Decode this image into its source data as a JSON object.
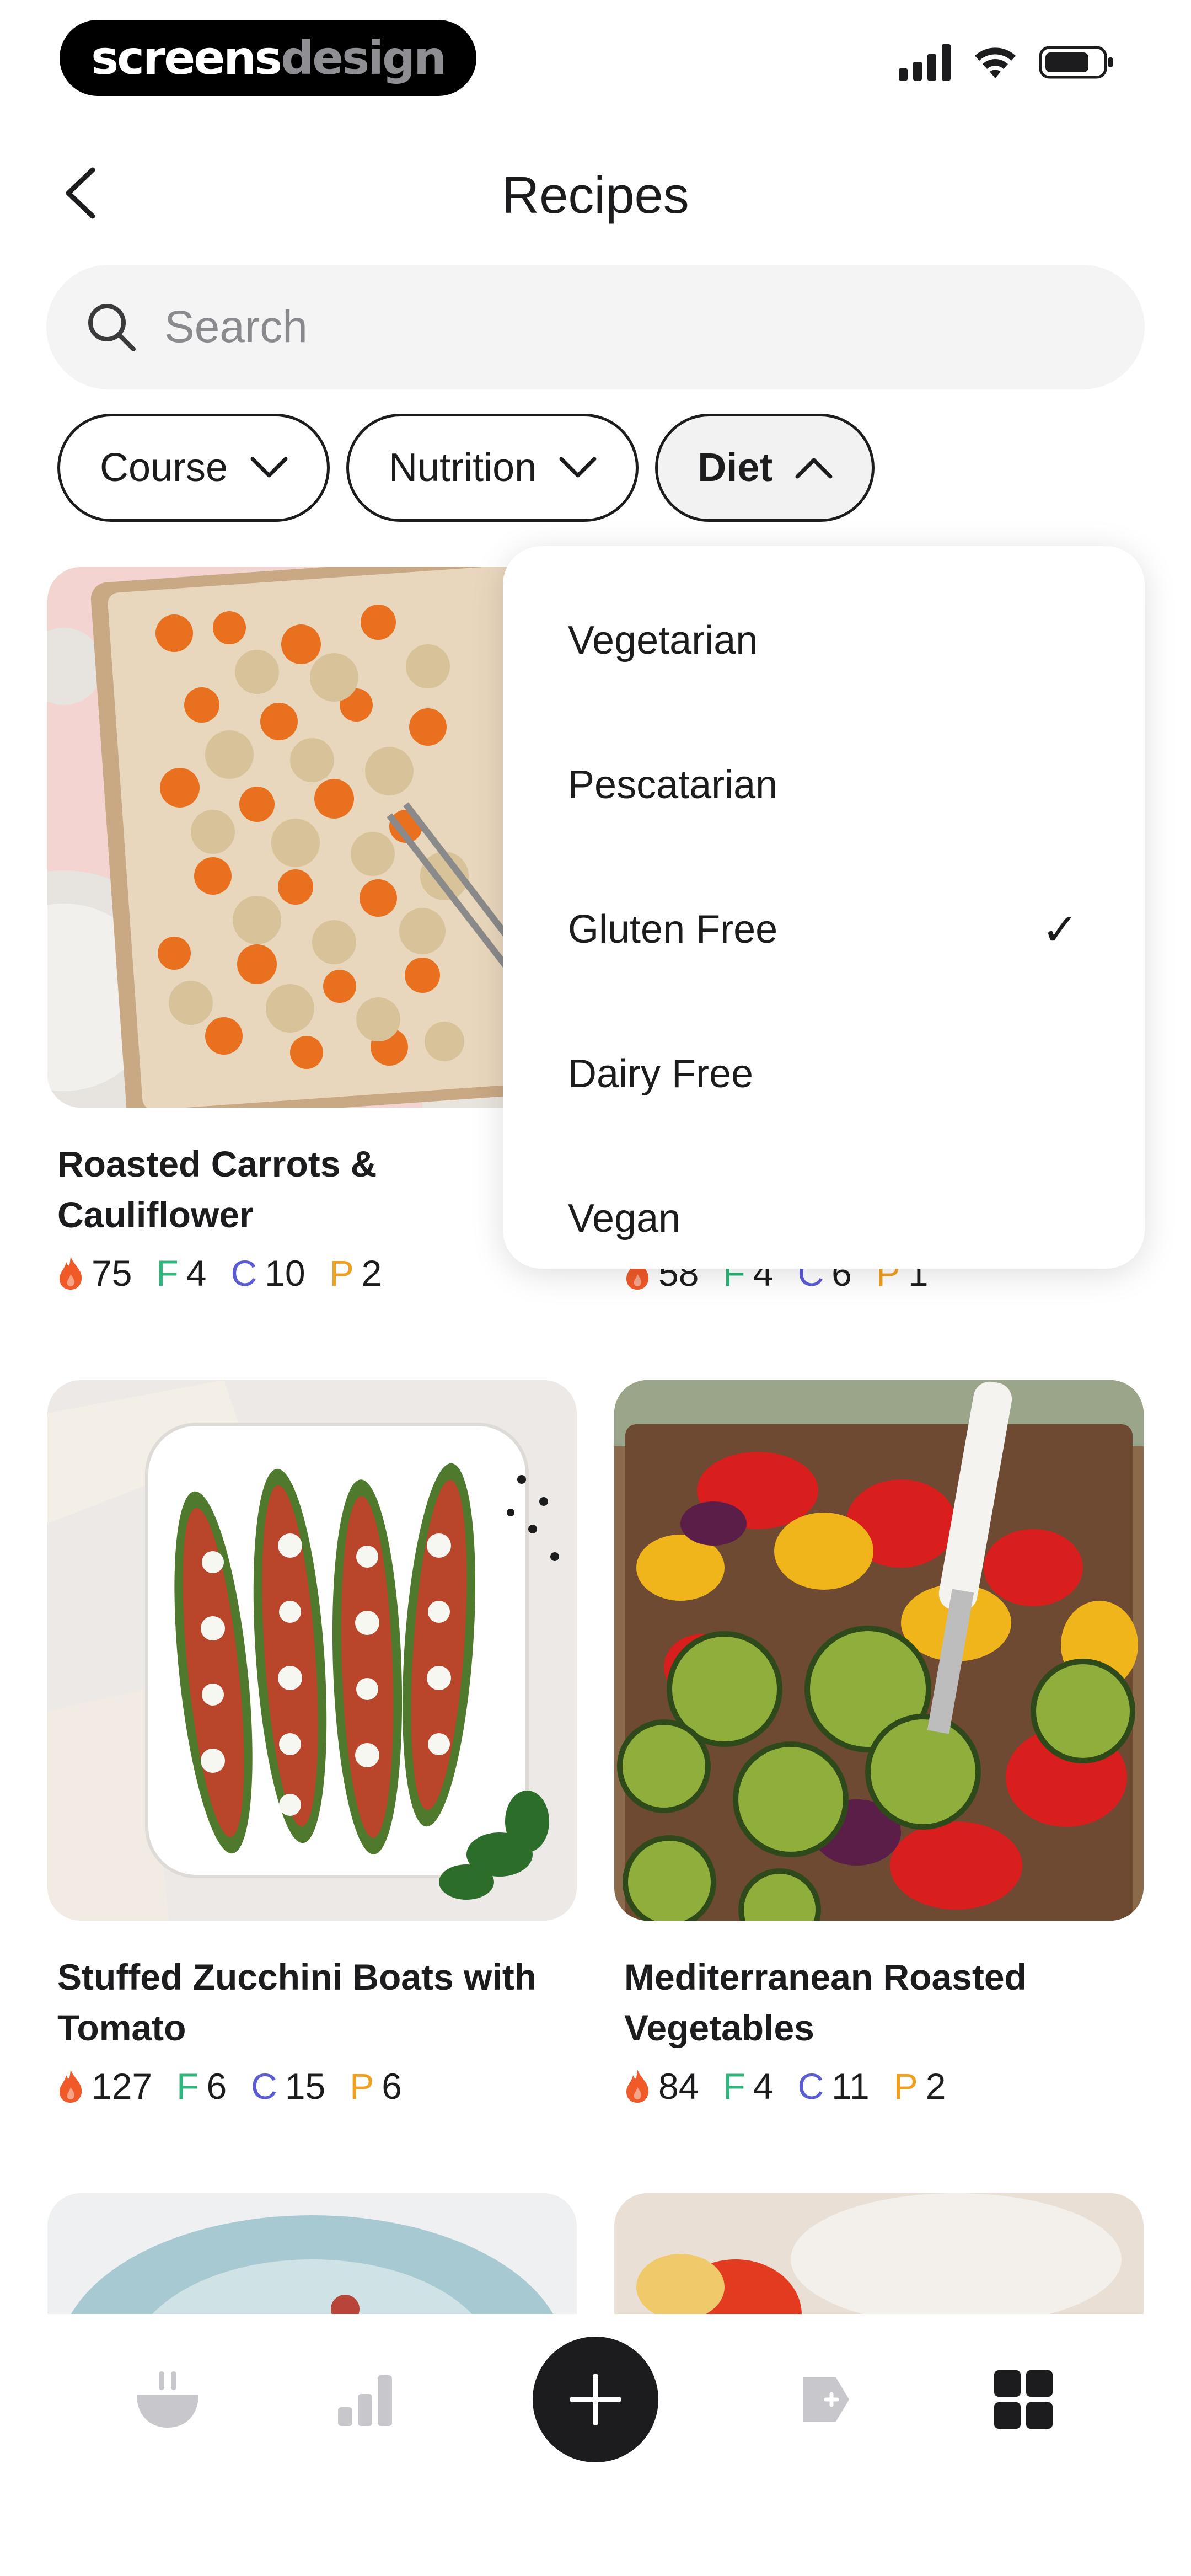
{
  "status_bar": {
    "brand_primary": "screens",
    "brand_secondary": "design"
  },
  "header": {
    "title": "Recipes"
  },
  "search": {
    "placeholder": "Search"
  },
  "filters": [
    {
      "label": "Course",
      "expanded": false
    },
    {
      "label": "Nutrition",
      "expanded": false
    },
    {
      "label": "Diet",
      "expanded": true
    }
  ],
  "diet_dropdown": {
    "options": [
      {
        "label": "Vegetarian",
        "selected": false
      },
      {
        "label": "Pescatarian",
        "selected": false
      },
      {
        "label": "Gluten Free",
        "selected": true
      },
      {
        "label": "Dairy Free",
        "selected": false
      },
      {
        "label": "Vegan",
        "selected": false
      }
    ],
    "check_glyph": "✓"
  },
  "recipes": [
    {
      "title": "Roasted Carrots & Cauliflower",
      "kcal": "75",
      "f_label": "F",
      "f": "4",
      "c_label": "C",
      "c": "10",
      "p_label": "P",
      "p": "2"
    },
    {
      "title": "",
      "kcal": "58",
      "f_label": "F",
      "f": "4",
      "c_label": "C",
      "c": "6",
      "p_label": "P",
      "p": "1"
    },
    {
      "title": "Stuffed Zucchini Boats with Tomato",
      "kcal": "127",
      "f_label": "F",
      "f": "6",
      "c_label": "C",
      "c": "15",
      "p_label": "P",
      "p": "6"
    },
    {
      "title": "Mediterranean Roasted Vegetables",
      "kcal": "84",
      "f_label": "F",
      "f": "4",
      "c_label": "C",
      "c": "11",
      "p_label": "P",
      "p": "2"
    }
  ],
  "colors": {
    "accent_dark": "#1c1c1e",
    "fat": "#2fb67c",
    "carbs": "#5b5bd6",
    "protein": "#f0a020",
    "calorie_flame": "#f05a28"
  },
  "bottom_nav": [
    "bowl-icon",
    "bar-chart-icon",
    "add-button",
    "tag-icon",
    "grid-icon"
  ]
}
